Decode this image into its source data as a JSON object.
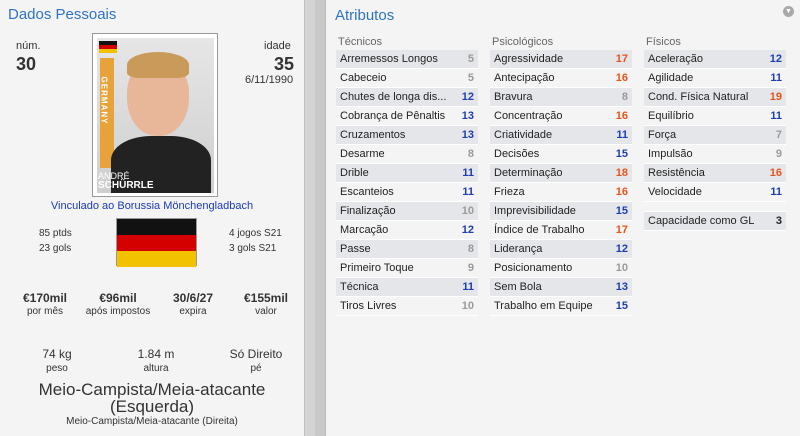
{
  "personal": {
    "title": "Dados Pessoais",
    "num_label": "núm.",
    "num_value": "30",
    "age_label": "idade",
    "age_value": "35",
    "dob": "6/11/1990",
    "photo_side_text": "GERMANY",
    "photo_name_first": "ANDRÉ",
    "photo_name_last": "SCHÜRRLE",
    "club_line": "Vinculado ao Borussia Mönchengladbach",
    "points": "85 ptds",
    "goals": "23 gols",
    "games_s21": "4 jogos S21",
    "goals_s21": "3 gols S21",
    "flag_colors": [
      "#111111",
      "#d40000",
      "#f2c200"
    ],
    "finance": [
      {
        "value": "€170mil",
        "label": "por mês"
      },
      {
        "value": "€96mil",
        "label": "após impostos"
      },
      {
        "value": "30/6/27",
        "label": "expira"
      },
      {
        "value": "€155mil",
        "label": "valor"
      }
    ],
    "physical": [
      {
        "value": "74 kg",
        "label": "peso"
      },
      {
        "value": "1.84 m",
        "label": "altura"
      },
      {
        "value": "Só Direito",
        "label": "pé"
      }
    ],
    "position_main": "Meio-Campista/Meia-atacante (Esquerda)",
    "position_sub": "Meio-Campista/Meia-atacante (Direita)"
  },
  "attributes": {
    "title": "Atributos",
    "colors": {
      "high": "#e8541c",
      "mid": "#1f3fae",
      "low": "#9a9a9a"
    },
    "tecnicos": {
      "header": "Técnicos",
      "items": [
        {
          "name": "Arremessos Longos",
          "value": "5",
          "level": "low"
        },
        {
          "name": "Cabeceio",
          "value": "5",
          "level": "low"
        },
        {
          "name": "Chutes de longa dis...",
          "value": "12",
          "level": "mid"
        },
        {
          "name": "Cobrança de Pênaltis",
          "value": "13",
          "level": "mid"
        },
        {
          "name": "Cruzamentos",
          "value": "13",
          "level": "mid"
        },
        {
          "name": "Desarme",
          "value": "8",
          "level": "low"
        },
        {
          "name": "Drible",
          "value": "11",
          "level": "mid"
        },
        {
          "name": "Escanteios",
          "value": "11",
          "level": "mid"
        },
        {
          "name": "Finalização",
          "value": "10",
          "level": "low"
        },
        {
          "name": "Marcação",
          "value": "12",
          "level": "mid"
        },
        {
          "name": "Passe",
          "value": "8",
          "level": "low"
        },
        {
          "name": "Primeiro Toque",
          "value": "9",
          "level": "low"
        },
        {
          "name": "Técnica",
          "value": "11",
          "level": "mid"
        },
        {
          "name": "Tiros Livres",
          "value": "10",
          "level": "low"
        }
      ]
    },
    "psicologicos": {
      "header": "Psicológicos",
      "items": [
        {
          "name": "Agressividade",
          "value": "17",
          "level": "high"
        },
        {
          "name": "Antecipação",
          "value": "16",
          "level": "high"
        },
        {
          "name": "Bravura",
          "value": "8",
          "level": "low"
        },
        {
          "name": "Concentração",
          "value": "16",
          "level": "high"
        },
        {
          "name": "Criatividade",
          "value": "11",
          "level": "mid"
        },
        {
          "name": "Decisões",
          "value": "15",
          "level": "mid"
        },
        {
          "name": "Determinação",
          "value": "18",
          "level": "high"
        },
        {
          "name": "Frieza",
          "value": "16",
          "level": "high"
        },
        {
          "name": "Imprevisibilidade",
          "value": "15",
          "level": "mid"
        },
        {
          "name": "Índice de Trabalho",
          "value": "17",
          "level": "high"
        },
        {
          "name": "Liderança",
          "value": "12",
          "level": "mid"
        },
        {
          "name": "Posicionamento",
          "value": "10",
          "level": "low"
        },
        {
          "name": "Sem Bola",
          "value": "13",
          "level": "mid"
        },
        {
          "name": "Trabalho em Equipe",
          "value": "15",
          "level": "mid"
        }
      ]
    },
    "fisicos": {
      "header": "Físicos",
      "items": [
        {
          "name": "Aceleração",
          "value": "12",
          "level": "mid"
        },
        {
          "name": "Agilidade",
          "value": "11",
          "level": "mid"
        },
        {
          "name": "Cond. Física Natural",
          "value": "19",
          "level": "high"
        },
        {
          "name": "Equilíbrio",
          "value": "11",
          "level": "mid"
        },
        {
          "name": "Força",
          "value": "7",
          "level": "low"
        },
        {
          "name": "Impulsão",
          "value": "9",
          "level": "low"
        },
        {
          "name": "Resistência",
          "value": "16",
          "level": "high"
        },
        {
          "name": "Velocidade",
          "value": "11",
          "level": "mid"
        }
      ],
      "gk": {
        "name": "Capacidade como GL",
        "value": "3"
      }
    }
  }
}
